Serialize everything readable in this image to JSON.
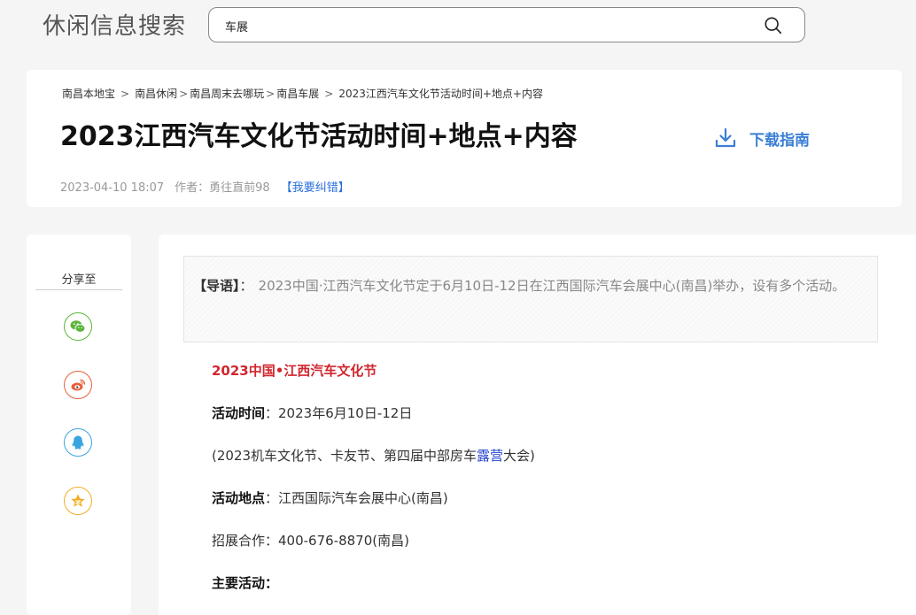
{
  "site": {
    "title": "休闲信息搜索"
  },
  "search": {
    "value": "车展",
    "icon": "search-icon"
  },
  "breadcrumb": [
    {
      "label": "南昌本地宝",
      "sep": ">"
    },
    {
      "label": "南昌休闲",
      "sep": ">"
    },
    {
      "label": "南昌周末去哪玩",
      "sep": ">"
    },
    {
      "label": "南昌车展",
      "sep": ">"
    },
    {
      "label": "2023江西汽车文化节活动时间+地点+内容"
    }
  ],
  "article": {
    "title": "2023江西汽车文化节活动时间+地点+内容",
    "download_label": "下载指南",
    "date": "2023-04-10 18:07",
    "author": "作者：勇往直前98",
    "report_label": "【我要纠错】"
  },
  "share": {
    "title": "分享至",
    "icons": [
      {
        "name": "wechat-icon",
        "color": "#5cb53a"
      },
      {
        "name": "weibo-icon",
        "color": "#e8603a"
      },
      {
        "name": "qq-icon",
        "color": "#3aa4e0"
      },
      {
        "name": "qzone-icon",
        "color": "#f2ad26"
      }
    ]
  },
  "lead": {
    "label": "【导语】",
    "colon": "：",
    "text": "2023中国·江西汽车文化节定于6月10日-12日在江西国际汽车会展中心(南昌)举办，设有多个活动。"
  },
  "content": {
    "heading": "2023中国•江西汽车文化节",
    "time_label": "活动时间",
    "time_value": "：2023年6月10日-12日",
    "sub_prefix": "(2023机车文化节、卡友节、第四届中部房车",
    "sub_link": "露营",
    "sub_suffix": "大会)",
    "place_label": "活动地点",
    "place_value": "：江西国际汽车会展中心(南昌)",
    "cooperation": "招展合作：400-676-8870(南昌)",
    "main_label": "主要活动",
    "main_colon": "："
  },
  "colors": {
    "accent_blue": "#3a7fd5",
    "heading_red": "#d0262e",
    "link_blue": "#1e3fcf"
  }
}
